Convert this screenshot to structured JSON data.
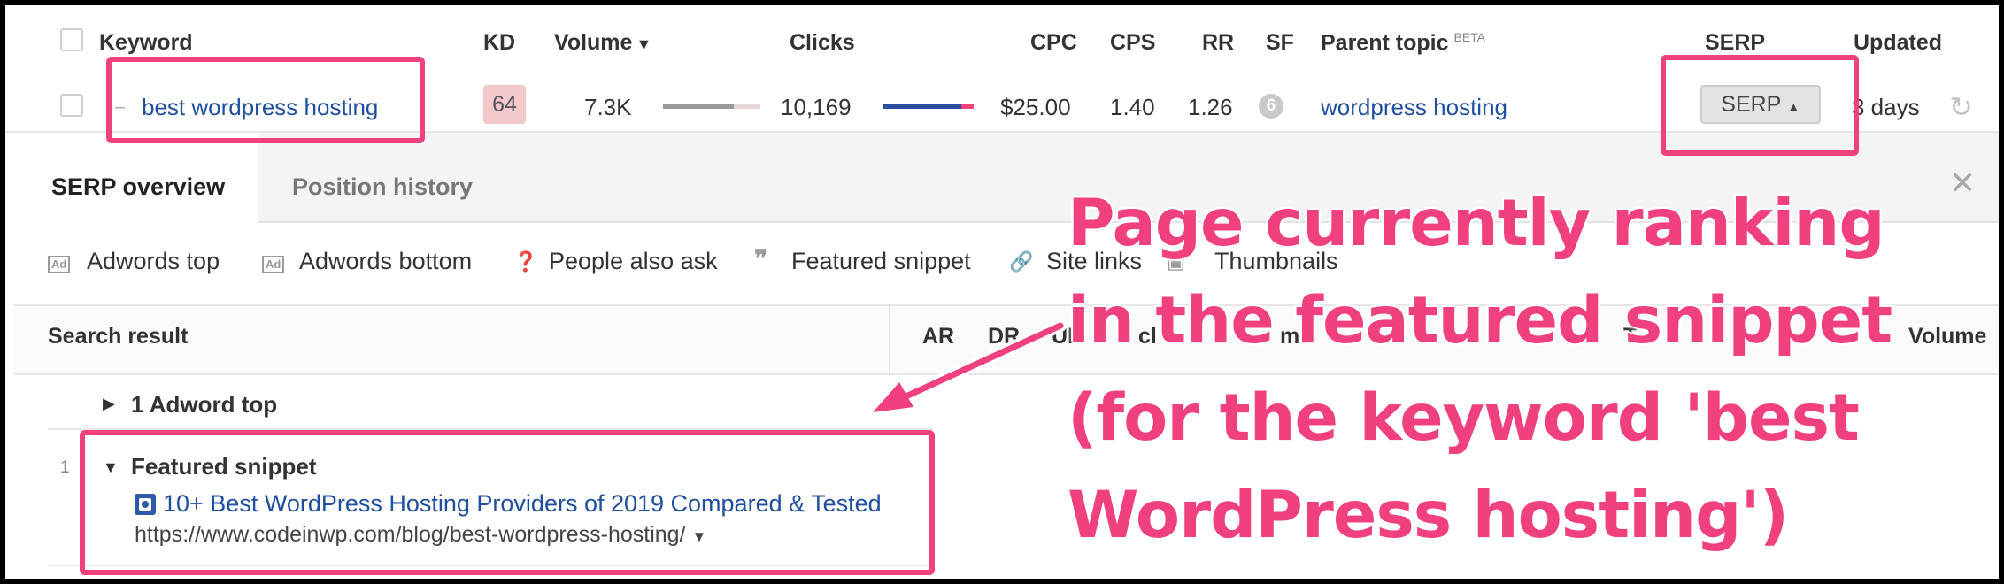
{
  "table": {
    "headers": {
      "keyword": "Keyword",
      "kd": "KD",
      "volume": "Volume",
      "clicks": "Clicks",
      "cpc": "CPC",
      "cps": "CPS",
      "rr": "RR",
      "sf": "SF",
      "parent_topic": "Parent topic",
      "beta": "BETA",
      "serp": "SERP",
      "updated": "Updated"
    },
    "row": {
      "keyword": "best wordpress hosting",
      "kd": "64",
      "volume": "7.3K",
      "clicks": "10,169",
      "cpc": "$25.00",
      "cps": "1.40",
      "rr": "1.26",
      "sf": "6",
      "parent_topic": "wordpress hosting",
      "serp_button": "SERP",
      "updated": "3 days"
    }
  },
  "panel": {
    "tabs": [
      "SERP overview",
      "Position history"
    ],
    "filters": [
      {
        "label": "Adwords top",
        "icon": "ad-icon"
      },
      {
        "label": "Adwords bottom",
        "icon": "ad-icon"
      },
      {
        "label": "People also ask",
        "icon": "question-icon"
      },
      {
        "label": "Featured snippet",
        "icon": "quote-icon"
      },
      {
        "label": "Site links",
        "icon": "link-icon"
      },
      {
        "label": "Thumbnails",
        "icon": "image-icon"
      }
    ],
    "columns": {
      "search_result": "Search result",
      "ar": "AR",
      "dr": "DR",
      "ur": "UR",
      "clicks_col": "cl",
      "traffic_col": "m",
      "t_col": "T",
      "volume": "Volume"
    },
    "results": {
      "adword_top": "1 Adword top",
      "position": "1",
      "featured_label": "Featured snippet",
      "featured_title": "10+ Best WordPress Hosting Providers of 2019 Compared & Tested",
      "featured_url": "https://www.codeinwp.com/blog/best-wordpress-hosting/"
    }
  },
  "annotation": {
    "lines": [
      "Page currently ranking",
      "in the featured snippet",
      "(for the keyword 'best",
      "WordPress hosting')"
    ]
  },
  "colors": {
    "accent_pink": "#f0407e",
    "link_blue": "#1f4fa0",
    "kd_badge": "#f3c9cd",
    "clicks_bar_blue": "#2a4f9e",
    "clicks_bar_pink": "#f0407e",
    "volume_bar": "#9a9a9a"
  }
}
